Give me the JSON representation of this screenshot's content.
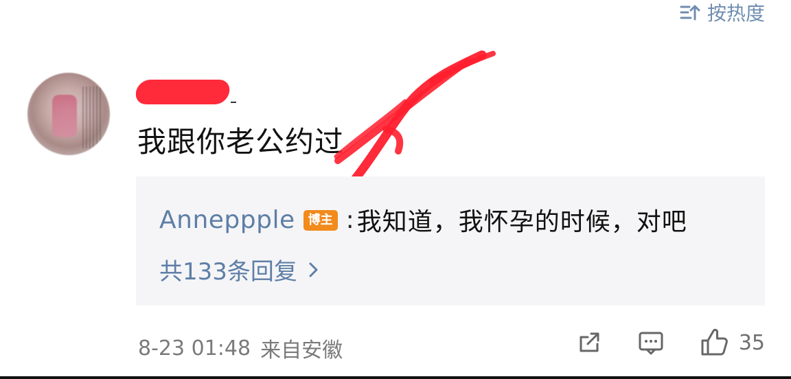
{
  "sort": {
    "label": "按热度"
  },
  "comment": {
    "username": "",
    "text": "我跟你老公约过",
    "reply": {
      "author": "Anneppple",
      "badge": "博主",
      "colon": ":",
      "text": "我知道，我怀孕的时候，对吧",
      "more": "共133条回复"
    },
    "time": "8-23 01:48",
    "source": "来自安徽",
    "likes": "35"
  },
  "icons": [
    "sort-icon",
    "chevron-right-icon",
    "share-icon",
    "comment-icon",
    "like-icon"
  ],
  "colors": {
    "link": "#5e7ea6",
    "badge": "#f28a1c",
    "redaction": "#ff1f2f",
    "reply_bg": "#f5f5f7"
  }
}
